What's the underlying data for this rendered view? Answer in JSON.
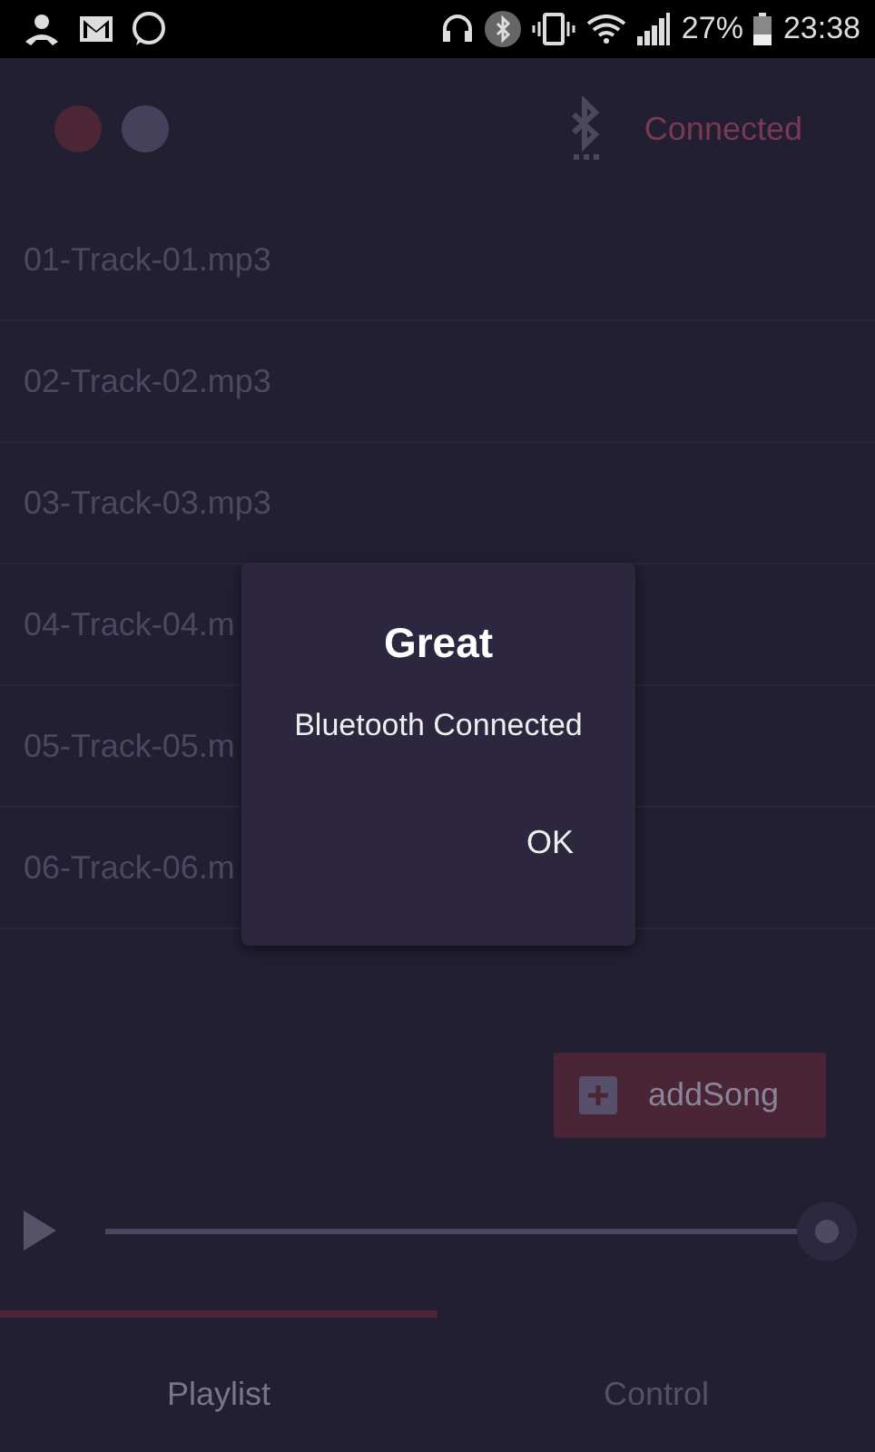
{
  "status_bar": {
    "battery": "27%",
    "time": "23:38"
  },
  "header": {
    "bluetooth_status": "Connected"
  },
  "tracks": [
    {
      "name": "01-Track-01.mp3"
    },
    {
      "name": "02-Track-02.mp3"
    },
    {
      "name": "03-Track-03.mp3"
    },
    {
      "name": "04-Track-04.m"
    },
    {
      "name": "05-Track-05.m"
    },
    {
      "name": "06-Track-06.m"
    }
  ],
  "add_button": {
    "label": "addSong"
  },
  "player": {
    "level": 1
  },
  "tabs": [
    {
      "label": "Playlist",
      "selected": true
    },
    {
      "label": "Control",
      "selected": false
    }
  ],
  "dialog": {
    "title": "Great",
    "message": "Bluetooth Connected",
    "button": "OK"
  }
}
